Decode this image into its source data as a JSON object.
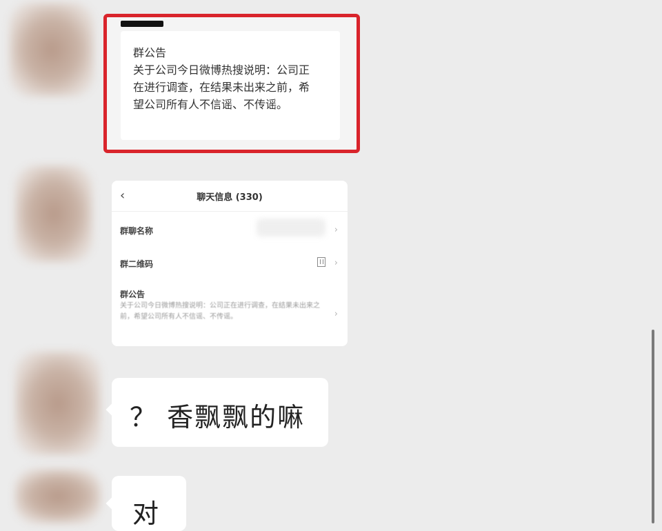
{
  "announcement": {
    "title": "群公告",
    "body": "关于公司今日微博热搜说明：公司正在进行调查，在结果未出来之前，希望公司所有人不信谣、不传谣。"
  },
  "chat_info": {
    "back_icon": "chevron-left-icon",
    "title": "聊天信息 (330)",
    "rows": {
      "group_name": {
        "label": "群聊名称"
      },
      "qr_code": {
        "label": "群二维码",
        "icon": "qr-code-icon"
      },
      "notice": {
        "label": "群公告",
        "preview": "关于公司今日微博热搜说明：公司正在进行调查，在结果未出来之前，希望公司所有人不信谣、不传谣。"
      }
    }
  },
  "messages": [
    {
      "text": "？ 香飘飘的嘛"
    },
    {
      "text": "对"
    }
  ],
  "colors": {
    "highlight_border": "#d9242b",
    "background": "#ececec",
    "bubble": "#ffffff"
  }
}
